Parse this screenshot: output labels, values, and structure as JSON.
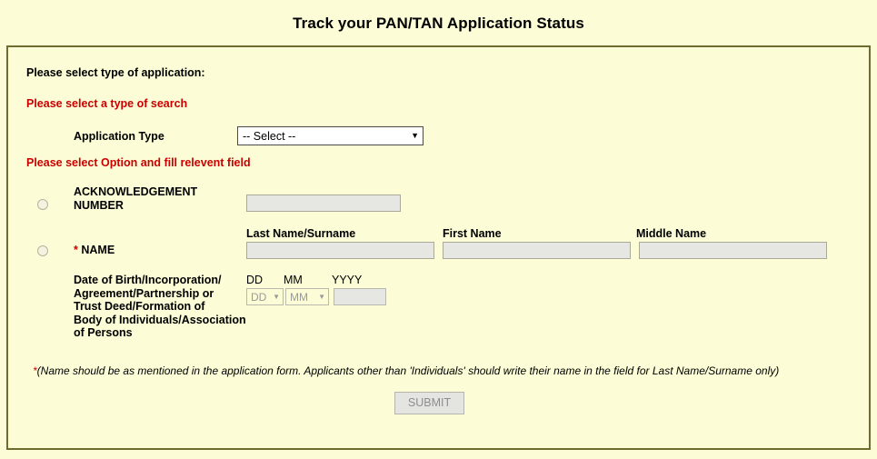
{
  "page": {
    "title": "Track your PAN/TAN Application Status"
  },
  "form": {
    "lead_label": "Please select type of application:",
    "notice_search": "Please select a type of search",
    "notice_option": "Please select Option and fill relevent field",
    "application_type": {
      "label": "Application Type",
      "selected": "-- Select --",
      "caret": "▼"
    },
    "options": {
      "acknowledgement": {
        "label_line1": "ACKNOWLEDGEMENT",
        "label_line2": "NUMBER",
        "value": "",
        "placeholder": ""
      },
      "name": {
        "star": "*",
        "label": "NAME",
        "headers": {
          "last": "Last Name/Surname",
          "first": "First Name",
          "middle": "Middle Name"
        },
        "values": {
          "last": "",
          "first": "",
          "middle": ""
        }
      }
    },
    "dob": {
      "label_line1": "Date of Birth/Incorporation/",
      "label_line2": "Agreement/Partnership or",
      "label_line3": "Trust Deed/Formation of",
      "label_line4": "Body of Individuals/Association of Persons",
      "head_dd": "DD",
      "head_mm": "MM",
      "head_yyyy": "YYYY",
      "dd_selected": "DD",
      "mm_selected": "MM",
      "year_value": "",
      "caret": "▼"
    },
    "footnote": {
      "star": "*",
      "text": "(Name should be as mentioned in the application form. Applicants other than 'Individuals' should write their name in the field for Last Name/Surname only)"
    },
    "submit_label": "SUBMIT"
  },
  "colors": {
    "background": "#fcfcd6",
    "border": "#6d6b2e",
    "notice_red": "#cc0000",
    "disabled_field": "#e6e6e3"
  }
}
